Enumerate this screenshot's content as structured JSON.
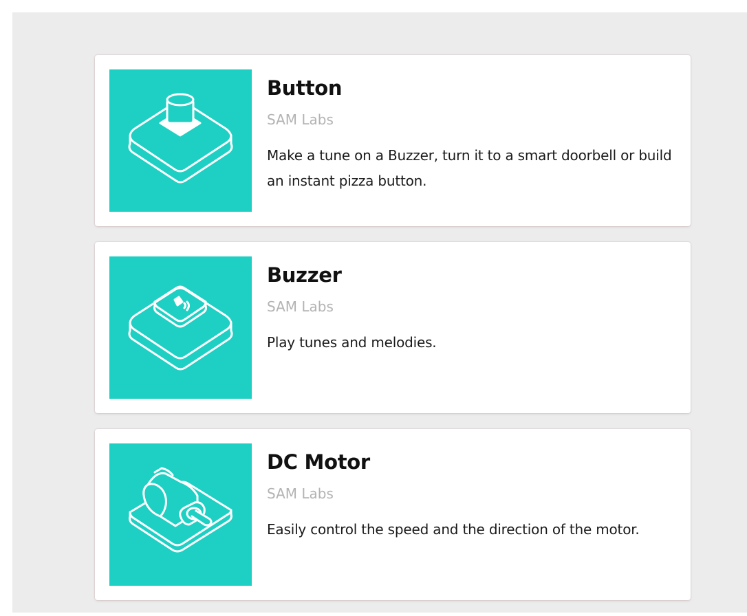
{
  "colors": {
    "page_background": "#ececec",
    "card_background": "#ffffff",
    "thumbnail_teal": "#1ecfc3",
    "title_text": "#111111",
    "vendor_text": "#b3b3b3",
    "description_text": "#1a1a1a"
  },
  "blocks": [
    {
      "title": "Button",
      "vendor": "SAM Labs",
      "description": "Make a tune on a Buzzer, turn it to a smart doorbell or build an instant pizza button.",
      "icon": "button-block-icon"
    },
    {
      "title": "Buzzer",
      "vendor": "SAM Labs",
      "description": "Play tunes and melodies.",
      "icon": "buzzer-block-icon"
    },
    {
      "title": "DC Motor",
      "vendor": "SAM Labs",
      "description": "Easily control the speed and the direction of the motor.",
      "icon": "dc-motor-block-icon"
    }
  ]
}
